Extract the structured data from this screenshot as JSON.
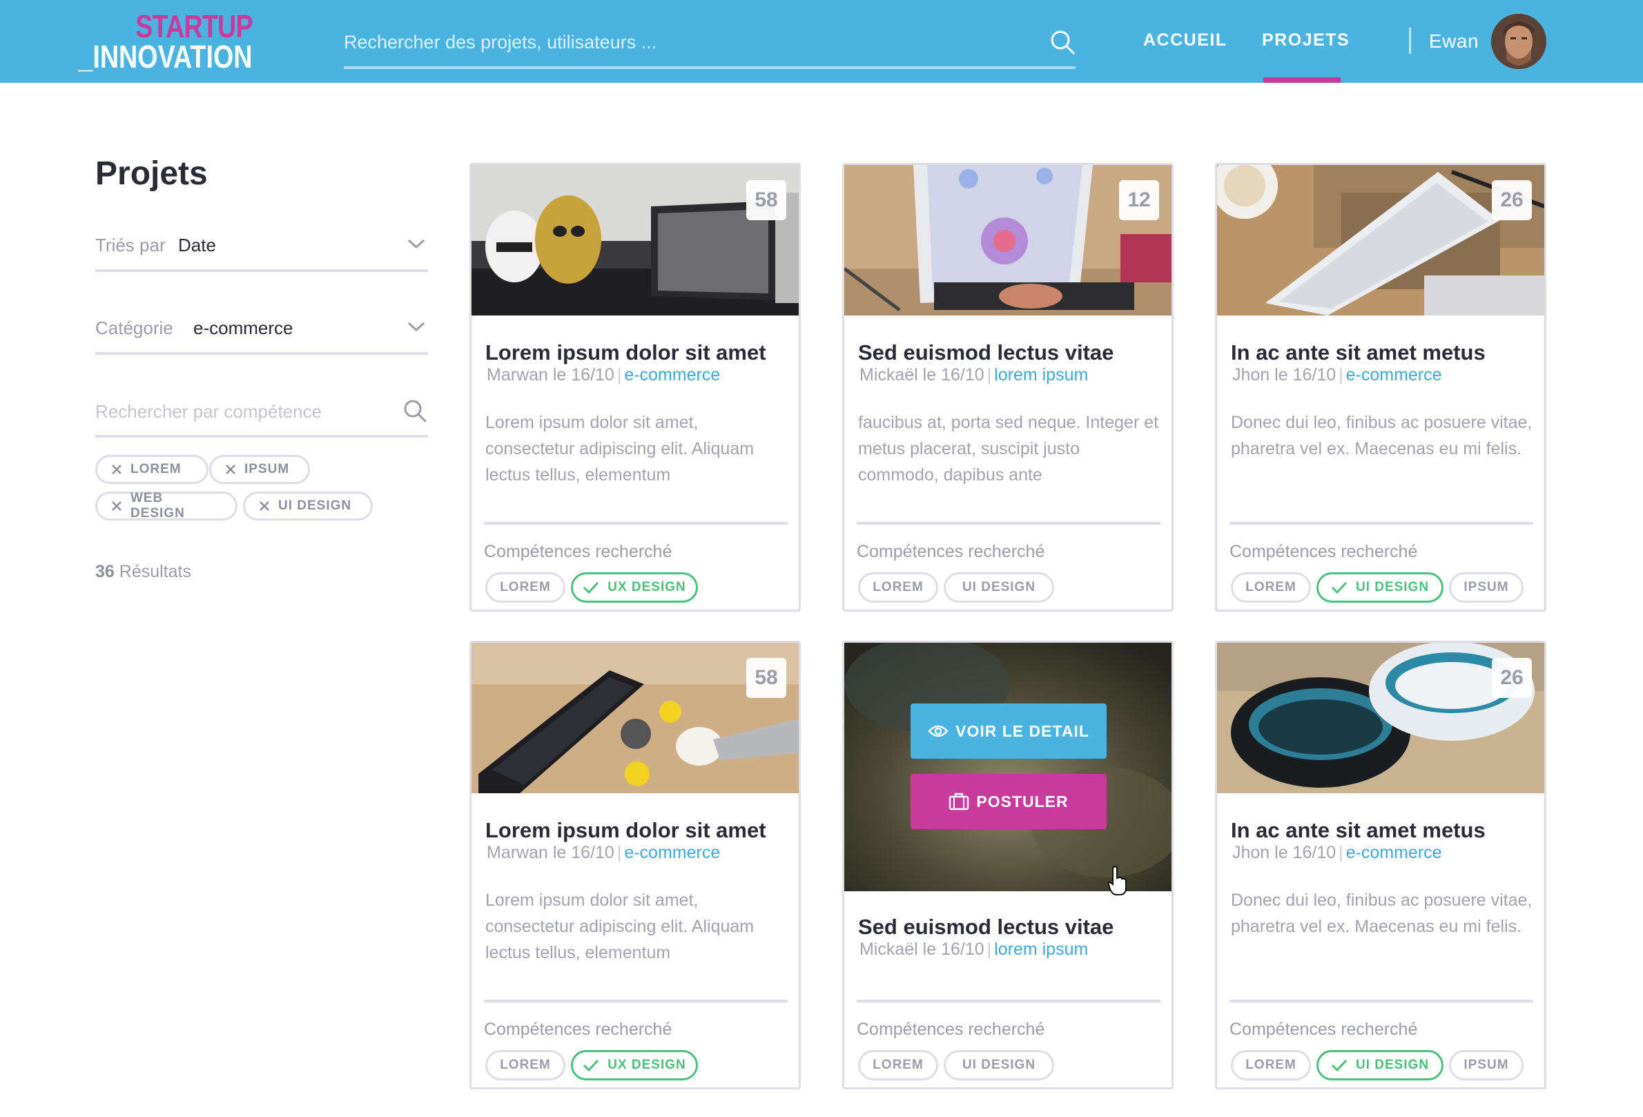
{
  "header": {
    "logo_top": "STARTUP",
    "logo_bottom": "_INNOVATION",
    "search_placeholder": "Rechercher des projets, utilisateurs ...",
    "nav": [
      {
        "label": "ACCUEIL",
        "active": false
      },
      {
        "label": "PROJETS",
        "active": true
      }
    ],
    "user_name": "Ewan",
    "colors": {
      "bar": "#4ab3e1",
      "accent": "#c83a9c"
    }
  },
  "sidebar": {
    "title": "Projets",
    "sort": {
      "label": "Triés par",
      "value": "Date"
    },
    "category": {
      "label": "Catégorie",
      "value": "e-commerce"
    },
    "skill_search_placeholder": "Rechercher par compétence",
    "tags": [
      "LOREM",
      "IPSUM",
      "WEB DESIGN",
      "UI DESIGN"
    ],
    "results_count": "36",
    "results_label": "Résultats"
  },
  "cards": [
    {
      "count": "58",
      "title": "Lorem ipsum dolor sit amet",
      "author": "Marwan le 16/10",
      "sep": "|",
      "category": "e-commerce",
      "desc": "Lorem ipsum dolor sit amet, consectetur adipiscing elit. Aliquam lectus tellus, elementum",
      "skills_label": "Compétences recherché",
      "skills": [
        {
          "label": "LOREM",
          "selected": false
        },
        {
          "label": "UX DESIGN",
          "selected": true
        }
      ]
    },
    {
      "count": "12",
      "title": "Sed euismod lectus vitae",
      "author": "Mickaël le 16/10",
      "sep": "|",
      "category": "lorem ipsum",
      "desc": "faucibus at, porta sed neque. Integer et metus placerat, suscipit justo commodo, dapibus ante",
      "skills_label": "Compétences recherché",
      "skills": [
        {
          "label": "LOREM",
          "selected": false
        },
        {
          "label": "UI DESIGN",
          "selected": false
        }
      ]
    },
    {
      "count": "26",
      "title": "In ac ante sit amet metus",
      "author": "Jhon le 16/10",
      "sep": "|",
      "category": "e-commerce",
      "desc": "Donec dui leo, finibus ac posuere vitae, pharetra vel ex. Maecenas eu mi felis.",
      "skills_label": "Compétences recherché",
      "skills": [
        {
          "label": "LOREM",
          "selected": false
        },
        {
          "label": "UI DESIGN",
          "selected": true
        },
        {
          "label": "IPSUM",
          "selected": false
        }
      ]
    },
    {
      "count": "58",
      "title": "Lorem ipsum dolor sit amet",
      "author": "Marwan le 16/10",
      "sep": "|",
      "category": "e-commerce",
      "desc": "Lorem ipsum dolor sit amet, consectetur adipiscing elit. Aliquam lectus tellus, elementum",
      "skills_label": "Compétences recherché",
      "skills": [
        {
          "label": "LOREM",
          "selected": false
        },
        {
          "label": "UX DESIGN",
          "selected": true
        }
      ]
    },
    {
      "title": "Sed euismod lectus vitae",
      "author": "Mickaël le 16/10",
      "sep": "|",
      "category": "lorem ipsum",
      "detail_button": "VOIR LE DETAIL",
      "apply_button": "POSTULER",
      "skills_label": "Compétences recherché",
      "skills": [
        {
          "label": "LOREM",
          "selected": false
        },
        {
          "label": "UI DESIGN",
          "selected": false
        }
      ]
    },
    {
      "count": "26",
      "title": "In ac ante sit amet metus",
      "author": "Jhon le 16/10",
      "sep": "|",
      "category": "e-commerce",
      "desc": "Donec dui leo, finibus ac posuere vitae, pharetra vel ex. Maecenas eu mi felis.",
      "skills_label": "Compétences recherché",
      "skills": [
        {
          "label": "LOREM",
          "selected": false
        },
        {
          "label": "UI DESIGN",
          "selected": true
        },
        {
          "label": "IPSUM",
          "selected": false
        }
      ]
    }
  ]
}
